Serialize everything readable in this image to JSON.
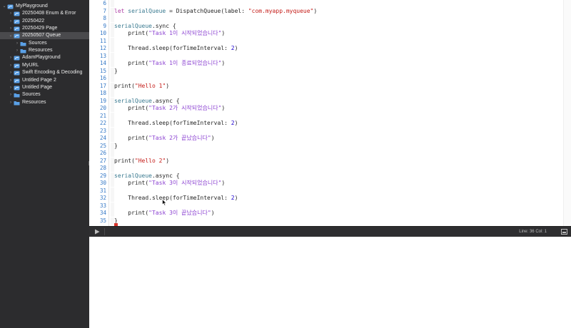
{
  "sidebar": {
    "items": [
      {
        "label": "MyPlayground",
        "icon": "playground-icon",
        "depth": 0,
        "expanded": true
      },
      {
        "label": "20250408 Enum & Error",
        "icon": "swift-page-icon",
        "depth": 1,
        "expanded": false
      },
      {
        "label": "20250422",
        "icon": "swift-page-icon",
        "depth": 1,
        "expanded": false
      },
      {
        "label": "20250429 Page",
        "icon": "swift-page-icon",
        "depth": 1,
        "expanded": false
      },
      {
        "label": "20250507 Queue",
        "icon": "swift-page-icon",
        "depth": 1,
        "expanded": true,
        "selected": true
      },
      {
        "label": "Sources",
        "icon": "folder-icon",
        "depth": 2,
        "expanded": false
      },
      {
        "label": "Resources",
        "icon": "folder-icon",
        "depth": 2,
        "expanded": false
      },
      {
        "label": "AdamPlayground",
        "icon": "swift-page-icon",
        "depth": 1,
        "expanded": false
      },
      {
        "label": "MyURL",
        "icon": "swift-page-icon",
        "depth": 1,
        "expanded": false
      },
      {
        "label": "Swift Encoding & Decoding",
        "icon": "swift-page-icon",
        "depth": 1,
        "expanded": false
      },
      {
        "label": "Untitled Page 2",
        "icon": "swift-page-icon",
        "depth": 1,
        "expanded": false
      },
      {
        "label": "Untitled Page",
        "icon": "swift-page-icon",
        "depth": 1,
        "expanded": false
      },
      {
        "label": "Sources",
        "icon": "folder-icon",
        "depth": 1,
        "expanded": false
      },
      {
        "label": "Resources",
        "icon": "folder-icon",
        "depth": 1,
        "expanded": false
      }
    ]
  },
  "editor": {
    "lines": [
      {
        "no": "6",
        "tokens": []
      },
      {
        "no": "7",
        "tokens": [
          [
            "kw",
            "let "
          ],
          [
            "id",
            "serialQueue"
          ],
          [
            "fn",
            " = DispatchQueue(label: "
          ],
          [
            "str",
            "\"com.myapp.myqueue\""
          ],
          [
            "fn",
            ")"
          ]
        ]
      },
      {
        "no": "8",
        "tokens": []
      },
      {
        "no": "9",
        "tokens": [
          [
            "id",
            "serialQueue"
          ],
          [
            "fn",
            ".sync {"
          ]
        ]
      },
      {
        "no": "10",
        "tokens": [
          [
            "fn",
            "    print("
          ],
          [
            "str ko",
            "\"Task 1이 시작되었습니다\""
          ],
          [
            "fn",
            ")"
          ]
        ]
      },
      {
        "no": "11",
        "tokens": []
      },
      {
        "no": "12",
        "tokens": [
          [
            "fn",
            "    Thread.sleep(forTimeInterval: "
          ],
          [
            "num",
            "2"
          ],
          [
            "fn",
            ")"
          ]
        ]
      },
      {
        "no": "13",
        "tokens": []
      },
      {
        "no": "14",
        "tokens": [
          [
            "fn",
            "    print("
          ],
          [
            "str ko",
            "\"Task 1이 종료되었습니다\""
          ],
          [
            "fn",
            ")"
          ]
        ]
      },
      {
        "no": "15",
        "tokens": [
          [
            "fn",
            "}"
          ]
        ]
      },
      {
        "no": "16",
        "tokens": []
      },
      {
        "no": "17",
        "tokens": [
          [
            "fn",
            "print("
          ],
          [
            "str",
            "\"Hello 1\""
          ],
          [
            "fn",
            ")"
          ]
        ]
      },
      {
        "no": "18",
        "tokens": []
      },
      {
        "no": "19",
        "tokens": [
          [
            "id",
            "serialQueue"
          ],
          [
            "fn",
            ".async {"
          ]
        ]
      },
      {
        "no": "20",
        "tokens": [
          [
            "fn",
            "    print("
          ],
          [
            "str ko",
            "\"Task 2가 시작되었습니다\""
          ],
          [
            "fn",
            ")"
          ]
        ]
      },
      {
        "no": "21",
        "tokens": []
      },
      {
        "no": "22",
        "tokens": [
          [
            "fn",
            "    Thread.sleep(forTimeInterval: "
          ],
          [
            "num",
            "2"
          ],
          [
            "fn",
            ")"
          ]
        ]
      },
      {
        "no": "23",
        "tokens": []
      },
      {
        "no": "24",
        "tokens": [
          [
            "fn",
            "    print("
          ],
          [
            "str ko",
            "\"Task 2가 끝났습니다\""
          ],
          [
            "fn",
            ")"
          ]
        ]
      },
      {
        "no": "25",
        "tokens": [
          [
            "fn",
            "}"
          ]
        ]
      },
      {
        "no": "26",
        "tokens": []
      },
      {
        "no": "27",
        "tokens": [
          [
            "fn",
            "print("
          ],
          [
            "str",
            "\"Hello 2\""
          ],
          [
            "fn",
            ")"
          ]
        ]
      },
      {
        "no": "28",
        "tokens": []
      },
      {
        "no": "29",
        "tokens": [
          [
            "id",
            "serialQueue"
          ],
          [
            "fn",
            ".async {"
          ]
        ]
      },
      {
        "no": "30",
        "tokens": [
          [
            "fn",
            "    print("
          ],
          [
            "str ko",
            "\"Task 3이 시작되었습니다\""
          ],
          [
            "fn",
            ")"
          ]
        ]
      },
      {
        "no": "31",
        "tokens": []
      },
      {
        "no": "32",
        "tokens": [
          [
            "fn",
            "    Thread.sleep(forTimeInterval: "
          ],
          [
            "num",
            "2"
          ],
          [
            "fn",
            ")"
          ]
        ]
      },
      {
        "no": "33",
        "tokens": []
      },
      {
        "no": "34",
        "tokens": [
          [
            "fn",
            "    print("
          ],
          [
            "str ko",
            "\"Task 3이 끝났습니다\""
          ],
          [
            "fn",
            ")"
          ]
        ]
      },
      {
        "no": "35",
        "tokens": [
          [
            "fn",
            "}"
          ]
        ]
      }
    ]
  },
  "statusbar": {
    "position": "Line: 36  Col: 1"
  },
  "colors": {
    "sidebar_bg": "#2c2c2e",
    "selection": "#4a4a4d",
    "swift_orange": "#f05138",
    "folder_blue": "#5aa0e6",
    "line_number": "#3478c6",
    "keyword": "#ad3da4",
    "string": "#c41a16"
  }
}
